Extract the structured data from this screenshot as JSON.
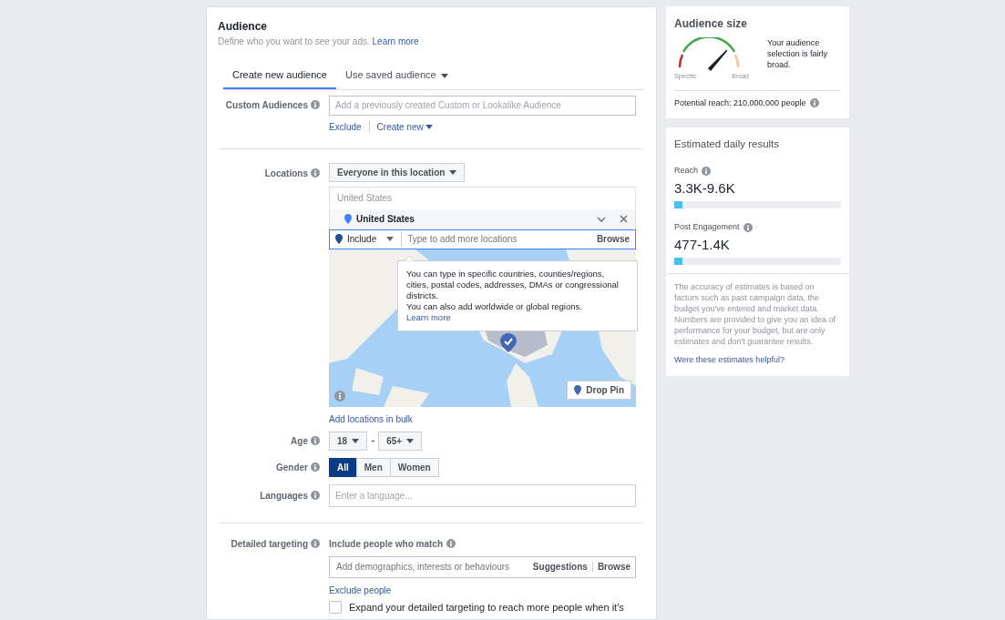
{
  "audience": {
    "title": "Audience",
    "subtitle": "Define who you want to see your ads.",
    "learn_more": "Learn more"
  },
  "tabs": [
    {
      "label": "Create new audience",
      "selected": true,
      "dropdown": false
    },
    {
      "label": "Use saved audience",
      "selected": false,
      "dropdown": true
    }
  ],
  "custom_audiences": {
    "label": "Custom Audiences",
    "placeholder": "Add a previously created Custom or Lookalike Audience",
    "exclude": "Exclude",
    "create_new": "Create new"
  },
  "locations": {
    "label": "Locations",
    "mode": "Everyone in this location",
    "search_header": "United States",
    "selected": [
      {
        "name": "United States"
      }
    ],
    "include": "Include",
    "placeholder": "Type to add more locations",
    "browse": "Browse",
    "tooltip": {
      "text": "You can type in specific countries, counties/regions, cities, postal codes, addresses, DMAs or congressional districts.",
      "text_2": "You can also add worldwide or global regions.",
      "link": "Learn more"
    },
    "drop_pin": "Drop Pin",
    "bulk_link": "Add locations in bulk"
  },
  "age": {
    "label": "Age",
    "min": "18",
    "separator": "-",
    "max": "65+"
  },
  "gender": {
    "label": "Gender",
    "options": [
      {
        "label": "All",
        "selected": true
      },
      {
        "label": "Men",
        "selected": false
      },
      {
        "label": "Women",
        "selected": false
      }
    ]
  },
  "languages": {
    "label": "Languages",
    "placeholder": "Enter a language..."
  },
  "detailed_targeting": {
    "label": "Detailed targeting",
    "sublabel": "Include people who match",
    "placeholder": "Add demographics, interests or behaviours",
    "suggestions": "Suggestions",
    "browse": "Browse",
    "exclude": "Exclude people",
    "expand_text": "Expand your detailed targeting to reach more people when it's",
    "expand_checked": false
  },
  "audience_size": {
    "title": "Audience size",
    "level": 0.75,
    "specific": "Specific",
    "broad": "Broad",
    "description": "Your audience selection is fairly broad.",
    "potential_reach": "Potential reach: 210,000,000 people"
  },
  "estimated": {
    "title": "Estimated daily results",
    "metrics": [
      {
        "label": "Reach",
        "value": "3.3K-9.6K",
        "level": 0.05
      },
      {
        "label": "Post Engagement",
        "value": "477-1.4K",
        "level": 0.05
      }
    ],
    "disclaimer": "The accuracy of estimates is based on factors such as past campaign data, the budget you've entered and market data. Numbers are provided to give you an idea of performance for your budget, but are only estimates and don't guarantee results.",
    "feedback": "Were these estimates helpful?"
  }
}
